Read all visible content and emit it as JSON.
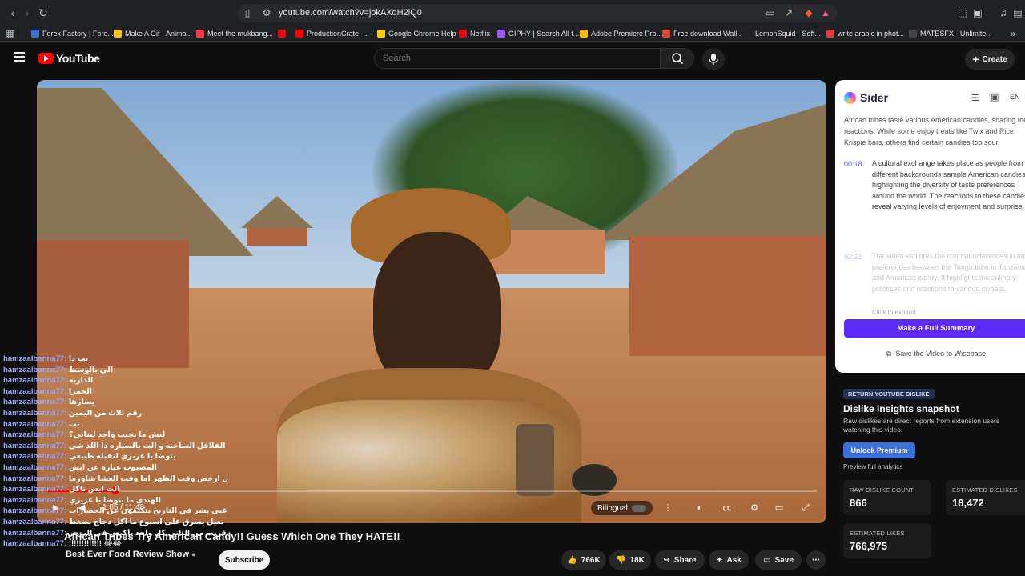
{
  "browser": {
    "url": "youtube.com/watch?v=jokAXdH2lQ0",
    "bookmarks": [
      {
        "label": "Forex Factory | Fore...",
        "color": "#3a6fd8"
      },
      {
        "label": "Make A Gif - Anima...",
        "color": "#f5c518"
      },
      {
        "label": "Meet the mukbang...",
        "color": "#ff3b3b"
      },
      {
        "label": "ProductionCrate -...",
        "color": "#ff0000"
      },
      {
        "label": "Google Chrome Help",
        "color": "#ffcc00"
      },
      {
        "label": "Netflix",
        "color": "#e50914"
      },
      {
        "label": "GIPHY | Search All t...",
        "color": "#9b59ff"
      },
      {
        "label": "Adobe Premiere Pro...",
        "color": "#fbbc05"
      },
      {
        "label": "Free download Wall...",
        "color": "#e04a2c"
      },
      {
        "label": "LemonSquid - Soft...",
        "color": "#222222"
      },
      {
        "label": "write arabic in phot...",
        "color": "#e53935"
      },
      {
        "label": "MATESFX - Unlimite...",
        "color": "#444444"
      }
    ]
  },
  "youtube": {
    "logo_text": "YouTube",
    "search_placeholder": "Search",
    "create_label": "Create"
  },
  "player": {
    "progress_fraction": 0.087,
    "time_text": "1:05 / 11:48",
    "bilingual_label": "Bilingual"
  },
  "chat": [
    {
      "user": "hamzaalbanna77:",
      "msg": "بب دا"
    },
    {
      "user": "hamzaalbanna77:",
      "msg": "الي بالوسط"
    },
    {
      "user": "hamzaalbanna77:",
      "msg": "الداريه"
    },
    {
      "user": "hamzaalbanna77:",
      "msg": "الحمرا"
    },
    {
      "user": "hamzaalbanna77:",
      "msg": "يسارها"
    },
    {
      "user": "hamzaalbanna77:",
      "msg": "رقم ثلاث من اليمين"
    },
    {
      "user": "hamzaalbanna77:",
      "msg": "بب"
    },
    {
      "user": "hamzaalbanna77:",
      "msg": "ليش ما يجيب واحد لبنانى؟"
    },
    {
      "user": "hamzaalbanna77:",
      "msg": "الفلافل الساخنه و الت بالسياره دا اللذ شي"
    },
    {
      "user": "hamzaalbanna77:",
      "msg": "يتوضا يا عزيزي لتقبله طبيعي"
    },
    {
      "user": "hamzaalbanna77:",
      "msg": "المصبوب عباره عن ايش"
    },
    {
      "user": "hamzaalbanna77:",
      "msg": "الفلافل ارخص وقت الظهر اما وقت العشا شاورما"
    },
    {
      "user": "hamzaalbanna77:",
      "msg": "الت ايش تاكل"
    },
    {
      "user": "hamzaalbanna77:",
      "msg": "الهندي ما يتوضا يا عزيزي"
    },
    {
      "user": "hamzaalbanna77:",
      "msg": "اغبى بشر في التاريخ يتكلمون عن الحضارات"
    },
    {
      "user": "hamzaalbanna77:",
      "msg": "تغيل يسرق على اسبوع ما اكل دجاج بضغط"
    },
    {
      "user": "hamzaalbanna77:",
      "msg": "البرجر ولا عمري شفت حد قريب من الثاني كل واحد يأكبس في البرجر"
    },
    {
      "user": "hamzaalbanna77:",
      "msg": "!!!!!!!!!!!!! 😂😂"
    }
  ],
  "video": {
    "title": "African Tribes Try American Candy!! Guess Which One They HATE!!",
    "channel": "Best Ever Food Review Show",
    "subscribe_label": "Subscribe",
    "likes": "766K",
    "dislikes": "18K",
    "share_label": "Share",
    "ask_label": "Ask",
    "save_label": "Save"
  },
  "sider": {
    "name": "Sider",
    "lang": "EN",
    "intro": "African tribes taste various American candies, sharing their reactions. While some enjoy treats like Twix and Rice Krispie bars, others find certain candies too sour.",
    "items": [
      {
        "ts": "00:18",
        "text": "A cultural exchange takes place as people from different backgrounds sample American candies, highlighting the diversity of taste preferences around the world. The reactions to these candies reveal varying levels of enjoyment and surprise."
      },
      {
        "ts": "02:21",
        "text": "The video explores the cultural differences in food preferences between the Tonga tribe in Tanzania and American candy. It highlights the culinary practices and reactions to various sweets."
      }
    ],
    "expand_label": "Click to expand",
    "full_summary_label": "Make a Full Summary",
    "wisebase_label": "Save the Video to Wisebase"
  },
  "dislike_panel": {
    "badge": "RETURN YOUTUBE DISLIKE",
    "heading": "Dislike insights snapshot",
    "description": "Raw dislikes are direct reports from extension users watching this video.",
    "unlock_label": "Unlock Premium",
    "preview_label": "Preview full analytics",
    "raw_label": "RAW DISLIKE COUNT",
    "raw_value": "866",
    "est_dislikes_label": "ESTIMATED DISLIKES",
    "est_dislikes_value": "18,472",
    "est_likes_label": "ESTIMATED LIKES",
    "est_likes_value": "766,975"
  }
}
